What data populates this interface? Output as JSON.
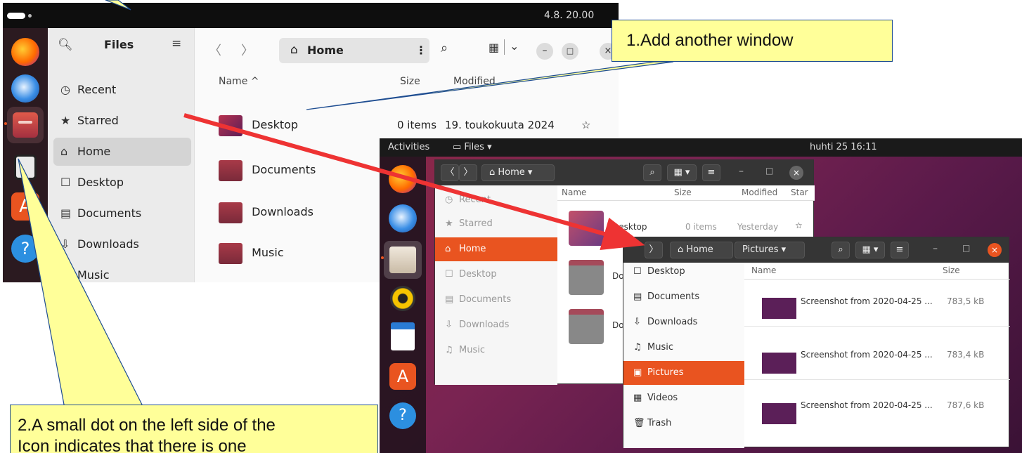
{
  "colors": {
    "ubuntu_orange": "#e95420",
    "callout_fill": "#ffff99",
    "arrow_red": "#ee3333"
  },
  "shot1": {
    "clock": "4.8. 20.00",
    "sidebar": {
      "title": "Files",
      "items": [
        {
          "icon": "clock-icon",
          "label": "Recent"
        },
        {
          "icon": "star-icon",
          "label": "Starred"
        },
        {
          "icon": "home-icon",
          "label": "Home",
          "selected": true
        },
        {
          "icon": "desktop-icon",
          "label": "Desktop"
        },
        {
          "icon": "document-icon",
          "label": "Documents"
        },
        {
          "icon": "download-icon",
          "label": "Downloads"
        },
        {
          "icon": "music-icon",
          "label": "Music"
        }
      ]
    },
    "toolbar": {
      "back": "〈",
      "forward": "〉",
      "location": "Home",
      "menu": "⋮"
    },
    "columns": {
      "name": "Name",
      "size": "Size",
      "modified": "Modified"
    },
    "rows": [
      {
        "name": "Desktop",
        "size": "0 items",
        "modified": "19. toukokuuta 2024"
      },
      {
        "name": "Documents"
      },
      {
        "name": "Downloads"
      },
      {
        "name": "Music"
      }
    ]
  },
  "shot2": {
    "topbar": {
      "activities": "Activities",
      "app": "Files ▾",
      "clock": "huhti 25  16:11"
    },
    "win_back": {
      "location": "Home",
      "columns": {
        "name": "Name",
        "size": "Size",
        "modified": "Modified",
        "star": "Star"
      },
      "sidebar": [
        "Recent",
        "Starred",
        "Home",
        "Desktop",
        "Documents",
        "Downloads",
        "Music"
      ],
      "rows": [
        {
          "name": "Desktop",
          "size": "0 items",
          "modified": "Yesterday"
        },
        {
          "name": "Do"
        },
        {
          "name": "Do"
        }
      ]
    },
    "win_front": {
      "location": "Home",
      "crumb": "Pictures",
      "columns": {
        "name": "Name",
        "size": "Size"
      },
      "sidebar": [
        "Desktop",
        "Documents",
        "Downloads",
        "Music",
        "Pictures",
        "Videos",
        "Trash"
      ],
      "files": [
        {
          "name": "Screenshot from 2020-04-25 ...",
          "size": "783,5 kB"
        },
        {
          "name": "Screenshot from 2020-04-25 ...",
          "size": "783,4 kB"
        },
        {
          "name": "Screenshot from 2020-04-25 ...",
          "size": "787,6 kB"
        }
      ]
    }
  },
  "callouts": {
    "one": "1.Add another window",
    "two_line1": "2.A small dot on the left side of the",
    "two_line2": "Icon indicates that there is one"
  }
}
